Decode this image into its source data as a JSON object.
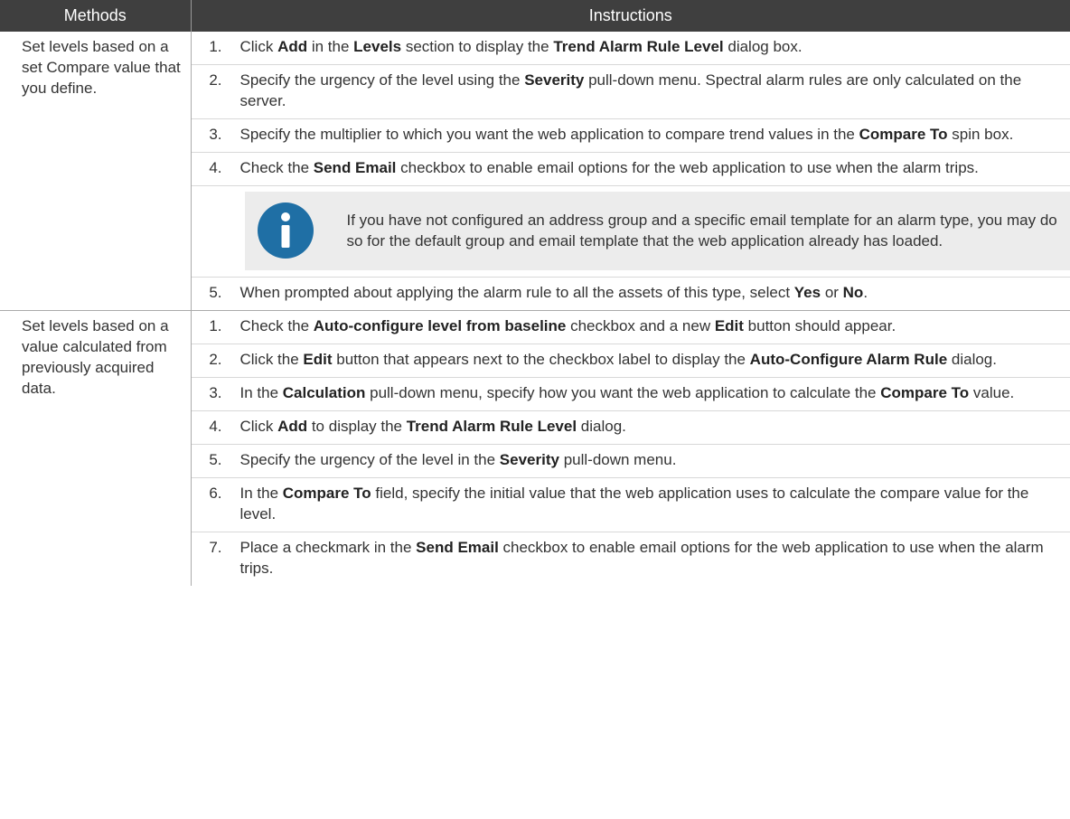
{
  "headers": {
    "methods": "Methods",
    "instructions": "Instructions"
  },
  "rows": [
    {
      "method": "Set levels based on a set Compare value that you define.",
      "steps": [
        {
          "num": "1.",
          "parts": [
            {
              "t": "Click "
            },
            {
              "t": "Add",
              "b": true
            },
            {
              "t": " in the "
            },
            {
              "t": "Levels",
              "b": true
            },
            {
              "t": " section to display the "
            },
            {
              "t": "Trend Alarm Rule Level",
              "b": true
            },
            {
              "t": " dialog box."
            }
          ]
        },
        {
          "num": "2.",
          "parts": [
            {
              "t": "Specify the urgency of the level using the "
            },
            {
              "t": "Severity",
              "b": true
            },
            {
              "t": " pull-down menu. Spectral alarm rules are only calculated on the server."
            }
          ]
        },
        {
          "num": "3.",
          "parts": [
            {
              "t": "Specify the multiplier to which you want the web application to compare trend values in the "
            },
            {
              "t": "Compare To",
              "b": true
            },
            {
              "t": " spin box."
            }
          ]
        },
        {
          "num": "4.",
          "parts": [
            {
              "t": "Check the "
            },
            {
              "t": "Send Email",
              "b": true
            },
            {
              "t": " checkbox to enable email options for the web application to use when the alarm trips."
            }
          ]
        },
        {
          "note": "If you have not configured an address group and a specific email template for an alarm type, you may do so for the default group and email template that the web application already has loaded.",
          "icon": "info-icon"
        },
        {
          "num": "5.",
          "parts": [
            {
              "t": "When prompted about applying the alarm rule to all the assets of this type, select "
            },
            {
              "t": "Yes",
              "b": true
            },
            {
              "t": " or "
            },
            {
              "t": "No",
              "b": true
            },
            {
              "t": "."
            }
          ]
        }
      ]
    },
    {
      "method": "Set levels based on a value calculated from previously acquired data.",
      "steps": [
        {
          "num": "1.",
          "parts": [
            {
              "t": "Check the "
            },
            {
              "t": "Auto-configure level from baseline",
              "b": true
            },
            {
              "t": " checkbox and a new "
            },
            {
              "t": "Edit",
              "b": true
            },
            {
              "t": " button should appear."
            }
          ]
        },
        {
          "num": "2.",
          "parts": [
            {
              "t": "Click the "
            },
            {
              "t": "Edit",
              "b": true
            },
            {
              "t": " button that appears next to the checkbox label to display the "
            },
            {
              "t": "Auto-Configure Alarm Rule",
              "b": true
            },
            {
              "t": " dialog."
            }
          ]
        },
        {
          "num": "3.",
          "parts": [
            {
              "t": "In the "
            },
            {
              "t": "Calculation",
              "b": true
            },
            {
              "t": " pull-down menu, specify how you want the web application to calculate the "
            },
            {
              "t": "Compare To",
              "b": true
            },
            {
              "t": " value."
            }
          ]
        },
        {
          "num": "4.",
          "parts": [
            {
              "t": "Click "
            },
            {
              "t": "Add",
              "b": true
            },
            {
              "t": " to display the "
            },
            {
              "t": "Trend Alarm Rule Level",
              "b": true
            },
            {
              "t": " dialog."
            }
          ]
        },
        {
          "num": "5.",
          "parts": [
            {
              "t": "Specify the urgency of the level in the "
            },
            {
              "t": "Severity",
              "b": true
            },
            {
              "t": " pull-down menu."
            }
          ]
        },
        {
          "num": "6.",
          "parts": [
            {
              "t": "In the "
            },
            {
              "t": "Compare To",
              "b": true
            },
            {
              "t": " field, specify the initial value that the web application uses to calculate the compare value for the level."
            }
          ]
        },
        {
          "num": "7.",
          "parts": [
            {
              "t": "Place a checkmark in the "
            },
            {
              "t": "Send Email",
              "b": true
            },
            {
              "t": " checkbox to enable email options for the web application to use when the alarm trips."
            }
          ]
        }
      ]
    }
  ],
  "colors": {
    "header_bg": "#3f3f3f",
    "note_bg": "#ececec",
    "info_icon": "#1f6fa5"
  }
}
